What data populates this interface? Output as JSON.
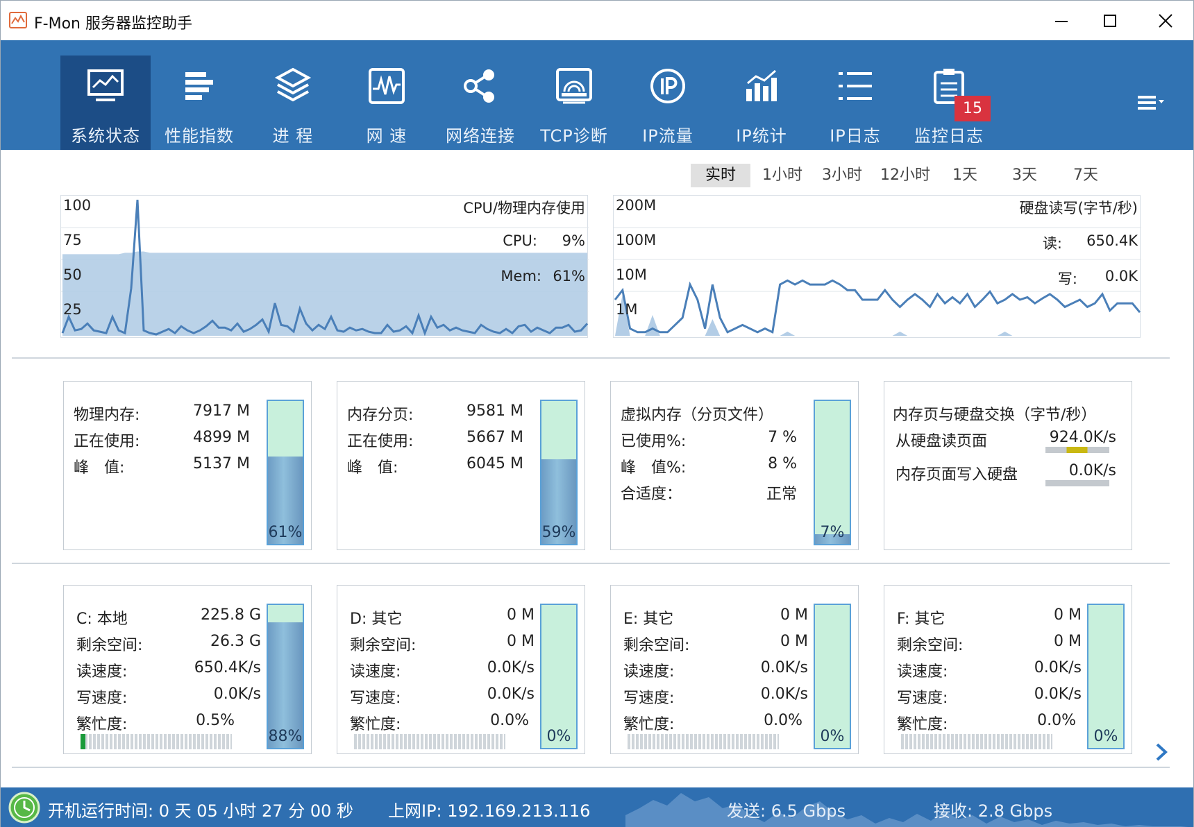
{
  "window": {
    "title": "F-Mon 服务器监控助手"
  },
  "toolbar": {
    "items": [
      {
        "label": "系统状态",
        "icon": "monitor-icon"
      },
      {
        "label": "性能指数",
        "icon": "bars-icon"
      },
      {
        "label": "进 程",
        "icon": "layers-icon"
      },
      {
        "label": "网 速",
        "icon": "pulse-icon"
      },
      {
        "label": "网络连接",
        "icon": "share-icon"
      },
      {
        "label": "TCP诊断",
        "icon": "radar-icon"
      },
      {
        "label": "IP流量",
        "icon": "ip-circle-icon"
      },
      {
        "label": "IP统计",
        "icon": "bar-chart-icon"
      },
      {
        "label": "IP日志",
        "icon": "list-icon"
      },
      {
        "label": "监控日志",
        "icon": "clipboard-icon"
      }
    ],
    "active_index": 0,
    "badge": "15",
    "accent": "#3173b3",
    "active_color": "#1c4d86"
  },
  "time_ranges": {
    "options": [
      "实时",
      "1小时",
      "3小时",
      "12小时",
      "1天",
      "3天",
      "7天"
    ],
    "selected": "实时"
  },
  "cpu_chart": {
    "title": "CPU/物理内存使用",
    "y_ticks": [
      "100",
      "75",
      "50",
      "25"
    ],
    "cpu_label": "CPU:",
    "cpu_value": "9%",
    "mem_label": "Mem:",
    "mem_value": "61%"
  },
  "disk_chart": {
    "title": "硬盘读写(字节/秒)",
    "y_ticks": [
      "200M",
      "100M",
      "10M",
      "1M"
    ],
    "read_label": "读:",
    "read_value": "650.4K",
    "write_label": "写:",
    "write_value": "0.0K"
  },
  "chart_data": [
    {
      "type": "line",
      "title": "CPU/物理内存使用",
      "ylim": [
        0,
        100
      ],
      "series": [
        {
          "name": "CPU",
          "values": [
            2,
            14,
            4,
            5,
            9,
            4,
            3,
            2,
            14,
            4,
            2,
            35,
            100,
            4,
            2,
            1,
            3,
            5,
            2,
            7,
            4,
            2,
            4,
            7,
            11,
            6,
            6,
            4,
            9,
            3,
            5,
            8,
            12,
            3,
            24,
            8,
            7,
            3,
            20,
            9,
            4,
            8,
            5,
            14,
            4,
            3,
            6,
            4,
            5,
            3,
            2,
            2,
            8,
            3,
            4,
            7,
            2,
            15,
            2,
            14,
            6,
            8,
            4,
            6,
            4,
            3,
            2,
            8,
            5,
            3,
            2,
            5,
            2,
            7,
            8,
            3,
            6,
            4,
            2,
            6,
            6,
            8,
            3,
            4,
            9
          ]
        },
        {
          "name": "Mem",
          "values": [
            60,
            60,
            60,
            60,
            60,
            60,
            60,
            60,
            60,
            60,
            61,
            61,
            62,
            62,
            61,
            61,
            61,
            61,
            61,
            61,
            61,
            61,
            61,
            61,
            61,
            61,
            61,
            61,
            61,
            61,
            61,
            61,
            61,
            61,
            61,
            61,
            61,
            61,
            61,
            61,
            61,
            61,
            61,
            61,
            61,
            61,
            61,
            61,
            61,
            61,
            61,
            61,
            61,
            61,
            61,
            61,
            61,
            61,
            61,
            61,
            61,
            61,
            61,
            61,
            61,
            61,
            61,
            61,
            61,
            61,
            61,
            61,
            61,
            61,
            61,
            61,
            61,
            61,
            61,
            61,
            61,
            61,
            61,
            61,
            61
          ]
        }
      ]
    },
    {
      "type": "line",
      "title": "硬盘读写(字节/秒)",
      "y_ticks": [
        "200M",
        "100M",
        "10M",
        "1M"
      ],
      "series": [
        {
          "name": "读",
          "values": [
            1,
            2,
            0.2,
            0.1,
            0.1,
            0.2,
            0.1,
            0.1,
            0.3,
            0.5,
            3,
            1,
            0.2,
            3,
            0.5,
            0.1,
            0.2,
            0.3,
            0.2,
            0.1,
            0.2,
            0.1,
            3,
            4,
            3,
            4,
            3,
            3,
            3,
            4,
            3,
            2,
            2,
            1,
            1,
            1,
            2,
            1,
            0.8,
            1,
            1.5,
            1,
            0.8,
            1.5,
            0.9,
            1.2,
            0.9,
            1.5,
            0.8,
            1,
            1.8,
            0.9,
            1,
            1.5,
            1,
            1.2,
            0.9,
            1.1,
            1.5,
            1,
            0.8,
            0.9,
            1,
            0.8,
            0.9,
            1.5,
            0.7,
            0.9,
            0.9,
            0.9,
            0.65
          ]
        },
        {
          "name": "写",
          "values": [
            0,
            1,
            0,
            0,
            0,
            0.5,
            0,
            0,
            0,
            0,
            0,
            0,
            0,
            0.4,
            0,
            0,
            0,
            0,
            0,
            0,
            0,
            0,
            0,
            0.1,
            0,
            0,
            0,
            0,
            0,
            0,
            0,
            0,
            0,
            0,
            0,
            0,
            0,
            0,
            0.1,
            0,
            0,
            0,
            0,
            0,
            0,
            0,
            0,
            0,
            0,
            0,
            0,
            0,
            0.1,
            0,
            0,
            0,
            0,
            0,
            0,
            0,
            0,
            0,
            0,
            0,
            0,
            0,
            0,
            0,
            0,
            0,
            0
          ]
        }
      ]
    }
  ],
  "memory_cards": [
    {
      "rows": [
        {
          "label": "物理内存:",
          "value": "7917 M"
        },
        {
          "label": "正在使用:",
          "value": "4899 M"
        },
        {
          "label": "峰　值:",
          "value": "5137 M"
        }
      ],
      "percent_label": "61%",
      "percent": 61
    },
    {
      "rows": [
        {
          "label": "内存分页:",
          "value": "9581 M"
        },
        {
          "label": "正在使用:",
          "value": "5667 M"
        },
        {
          "label": "峰　值:",
          "value": "6045 M"
        }
      ],
      "percent_label": "59%",
      "percent": 59
    },
    {
      "rows": [
        {
          "label": "虚拟内存（分页文件）",
          "value": ""
        },
        {
          "label": "已使用%:",
          "value": "7 %"
        },
        {
          "label": "峰　值%:",
          "value": "8 %"
        },
        {
          "label": "合适度：",
          "value": "正常"
        }
      ],
      "percent_label": "7%",
      "percent": 7
    },
    {
      "title": "内存页与硬盘交换（字节/秒）",
      "rows": [
        {
          "label": "从硬盘读页面",
          "value": "924.0K/s"
        },
        {
          "label": "内存页面写入硬盘",
          "value": "0.0K/s"
        }
      ]
    }
  ],
  "disks": [
    {
      "name": "C: 本地",
      "total": "225.8 G",
      "free_label": "剩余空间:",
      "free": "26.3 G",
      "read_label": "读速度:",
      "read": "650.4K/s",
      "write_label": "写速度:",
      "write": "0.0K/s",
      "busy_label": "繁忙度:",
      "busy": "0.5%",
      "busy_fraction": 0.02,
      "percent_label": "88%",
      "percent": 88
    },
    {
      "name": "D: 其它",
      "total": "0 M",
      "free_label": "剩余空间:",
      "free": "0 M",
      "read_label": "读速度:",
      "read": "0.0K/s",
      "write_label": "写速度:",
      "write": "0.0K/s",
      "busy_label": "繁忙度:",
      "busy": "0.0%",
      "busy_fraction": 0,
      "percent_label": "0%",
      "percent": 0
    },
    {
      "name": "E: 其它",
      "total": "0 M",
      "free_label": "剩余空间:",
      "free": "0 M",
      "read_label": "读速度:",
      "read": "0.0K/s",
      "write_label": "写速度:",
      "write": "0.0K/s",
      "busy_label": "繁忙度:",
      "busy": "0.0%",
      "busy_fraction": 0,
      "percent_label": "0%",
      "percent": 0
    },
    {
      "name": "F: 其它",
      "total": "0 M",
      "free_label": "剩余空间:",
      "free": "0 M",
      "read_label": "读速度:",
      "read": "0.0K/s",
      "write_label": "写速度:",
      "write": "0.0K/s",
      "busy_label": "繁忙度:",
      "busy": "0.0%",
      "busy_fraction": 0,
      "percent_label": "0%",
      "percent": 0
    }
  ],
  "status": {
    "uptime": "开机运行时间:  0  天  05  小时  27  分  00  秒",
    "ip": "上网IP:  192.169.213.116",
    "send": "发送: 6.5 Gbps",
    "recv": "接收: 2.8 Gbps"
  }
}
